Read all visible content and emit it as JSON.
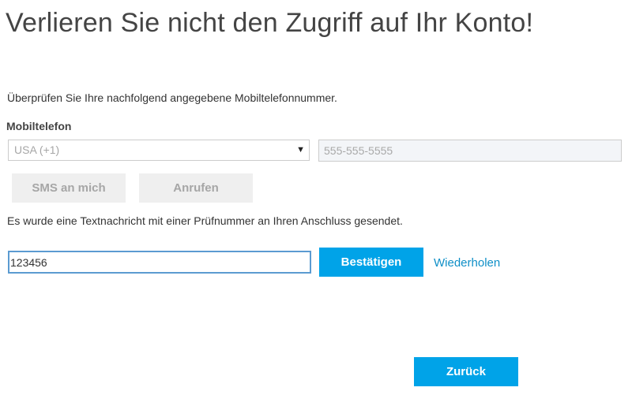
{
  "header": {
    "title": "Verlieren Sie nicht den Zugriff auf Ihr Konto!"
  },
  "form": {
    "instruction": "Überprüfen Sie Ihre nachfolgend angegebene Mobiltelefonnummer.",
    "phone_label": "Mobiltelefon",
    "country_select": {
      "selected": "USA (+1)",
      "caret_icon": "triangle-down-icon"
    },
    "phone_input": {
      "value": "",
      "placeholder": "555-555-5555"
    },
    "sms_button_label": "SMS an mich",
    "call_button_label": "Anrufen",
    "sent_message": "Es wurde eine Textnachricht mit einer Prüfnummer an Ihren Anschluss gesendet.",
    "code_input": {
      "value": "123456"
    },
    "confirm_button_label": "Bestätigen",
    "resend_link_label": "Wiederholen",
    "back_button_label": "Zurück"
  },
  "colors": {
    "accent": "#00a3e8",
    "link": "#0f8fc7",
    "disabled_button_bg": "#efefef",
    "disabled_text": "#a6a6a6",
    "focus_border": "#5b9bd1"
  }
}
